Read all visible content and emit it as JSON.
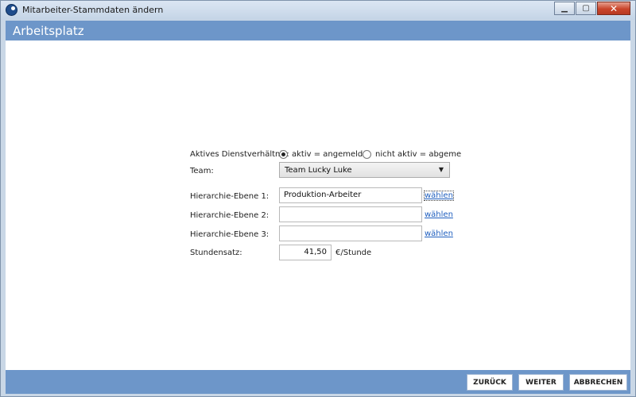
{
  "window": {
    "title": "Mitarbeiter-Stammdaten ändern"
  },
  "window_controls": {
    "minimize": "▁",
    "maximize": "▢",
    "close": "✕"
  },
  "header": {
    "title": "Arbeitsplatz"
  },
  "form": {
    "employment_label": "Aktives Dienstverhältnis:",
    "employment_options": [
      {
        "label": "aktiv = angemeldet",
        "checked": true
      },
      {
        "label": "nicht aktiv = abgeme",
        "checked": false
      }
    ],
    "team_label": "Team:",
    "team_value": "Team Lucky Luke",
    "dropdown_arrow": "▼",
    "hierarchy": [
      {
        "label": "Hierarchie-Ebene 1:",
        "value": "Produktion-Arbeiter",
        "link": "wählen"
      },
      {
        "label": "Hierarchie-Ebene 2:",
        "value": "",
        "link": "wählen"
      },
      {
        "label": "Hierarchie-Ebene 3:",
        "value": "",
        "link": "wählen"
      }
    ],
    "rate_label": "Stundensatz:",
    "rate_value": "41,50",
    "rate_unit": "€/Stunde"
  },
  "footer": {
    "back": "ZURÜCK",
    "next": "WEITER",
    "cancel": "ABBRECHEN"
  }
}
